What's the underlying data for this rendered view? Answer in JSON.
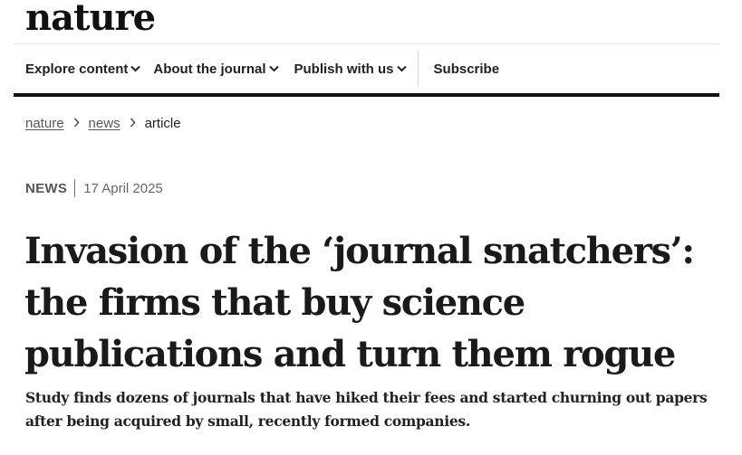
{
  "site": {
    "logo_text": "nature"
  },
  "nav": {
    "items": [
      {
        "label": "Explore content",
        "icon": "chevron-down-icon"
      },
      {
        "label": "About the journal",
        "icon": "chevron-down-icon"
      },
      {
        "label": "Publish with us",
        "icon": "chevron-down-icon"
      }
    ],
    "subscribe_label": "Subscribe"
  },
  "breadcrumb": {
    "items": [
      "nature",
      "news"
    ],
    "current": "article",
    "separator_icon": "chevron-right-icon"
  },
  "article": {
    "type": "NEWS",
    "date": "17 April 2025",
    "headline_lines": [
      "Invasion of the ‘journal snatchers’:",
      "the firms that buy science",
      "publications and turn them rogue"
    ],
    "standfirst_lines": [
      "Study finds dozens of journals that have hiked their fees and started churning out papers",
      "after being acquired by small, recently formed companies."
    ]
  },
  "colors": {
    "text": "#222222",
    "rule": "#111111",
    "muted": "#555555"
  }
}
